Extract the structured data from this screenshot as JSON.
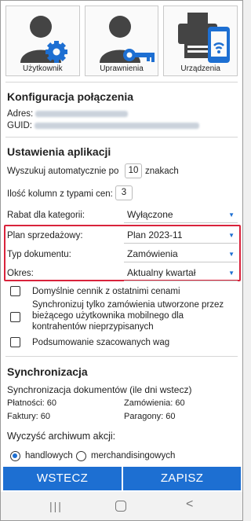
{
  "tiles": [
    {
      "label": "Użytkownik",
      "icon": "user-gear-icon"
    },
    {
      "label": "Uprawnienia",
      "icon": "user-key-icon"
    },
    {
      "label": "Urządzenia",
      "icon": "devices-icon"
    }
  ],
  "connection": {
    "title": "Konfiguracja połączenia",
    "address_label": "Adres:",
    "guid_label": "GUID:"
  },
  "app_settings": {
    "title": "Ustawienia aplikacji",
    "autosearch_prefix": "Wyszukuj automatycznie po",
    "autosearch_value": "10",
    "autosearch_suffix": "znakach",
    "price_columns_label": "Ilość kolumn z typami cen:",
    "price_columns_value": "3"
  },
  "selects": [
    {
      "label": "Rabat dla kategorii:",
      "value": "Wyłączone"
    },
    {
      "label": "Plan sprzedażowy:",
      "value": "Plan 2023-11"
    },
    {
      "label": "Typ dokumentu:",
      "value": "Zamówienia"
    },
    {
      "label": "Okres:",
      "value": "Aktualny kwartał"
    }
  ],
  "checkboxes": [
    {
      "label": "Domyślnie cennik z ostatnimi cenami",
      "checked": false
    },
    {
      "label": "Synchronizuj tylko zamówienia utworzone przez bieżącego użytkownika mobilnego dla kontrahentów nieprzypisanych",
      "checked": false
    },
    {
      "label": "Podsumowanie szacowanych wag",
      "checked": false
    }
  ],
  "sync": {
    "title": "Synchronizacja",
    "subtitle": "Synchronizacja dokumentów (ile dni wstecz)",
    "payments": "Płatności: 60",
    "orders": "Zamówienia: 60",
    "invoices": "Faktury: 60",
    "receipts": "Paragony: 60",
    "archive_label": "Wyczyść archiwum akcji:",
    "radio_trade": "handlowych",
    "radio_merch": "merchandisingowych"
  },
  "buttons": {
    "back": "WSTECZ",
    "save": "ZAPISZ"
  },
  "colors": {
    "accent": "#1d6fd2",
    "highlight": "#d9233b"
  }
}
